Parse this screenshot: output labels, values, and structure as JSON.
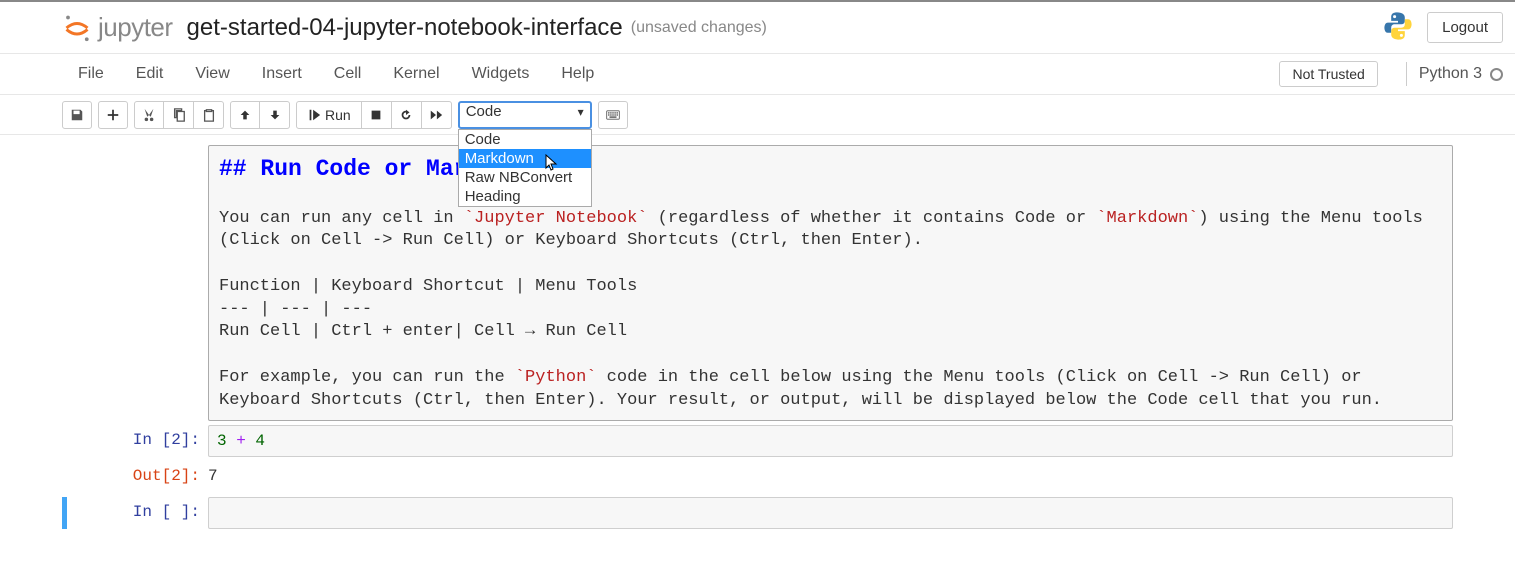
{
  "header": {
    "logo_text": "jupyter",
    "notebook_name": "get-started-04-jupyter-notebook-interface",
    "save_status": "(unsaved changes)",
    "logout": "Logout"
  },
  "menubar": {
    "items": [
      "File",
      "Edit",
      "View",
      "Insert",
      "Cell",
      "Kernel",
      "Widgets",
      "Help"
    ],
    "trusted": "Not Trusted",
    "kernel": "Python 3"
  },
  "toolbar": {
    "run_label": "Run",
    "cell_type_selected": "Code",
    "cell_type_options": [
      "Code",
      "Markdown",
      "Raw NBConvert",
      "Heading"
    ],
    "highlighted_option_index": 1
  },
  "cells": {
    "markdown": {
      "heading": "## Run Code or Markdown",
      "p1a": "You can run any cell in ",
      "p1_code1": "`Jupyter Notebook`",
      "p1b": " (regardless of whether it contains Code or ",
      "p1_code2": "`Markdown`",
      "p1c": ") using the Menu tools (Click on Cell -> Run Cell) or Keyboard Shortcuts (Ctrl, then Enter).",
      "table_header": "Function  | Keyboard Shortcut | Menu Tools",
      "table_sep": "--- | --- | ---",
      "table_row": "Run Cell  | Ctrl + enter| Cell → Run Cell",
      "p2a": "For example, you can run the ",
      "p2_code1": "`Python`",
      "p2b": " code in the cell below using the Menu tools (Click on Cell -> Run Cell) or Keyboard Shortcuts (Ctrl, then Enter).  Your result, or output, will be displayed below the Code cell that you run."
    },
    "code1": {
      "in_prompt": "In [2]:",
      "out_prompt": "Out[2]:",
      "num1": "3",
      "op": " + ",
      "num2": "4",
      "output": "7"
    },
    "code2": {
      "in_prompt": "In [ ]:"
    }
  }
}
